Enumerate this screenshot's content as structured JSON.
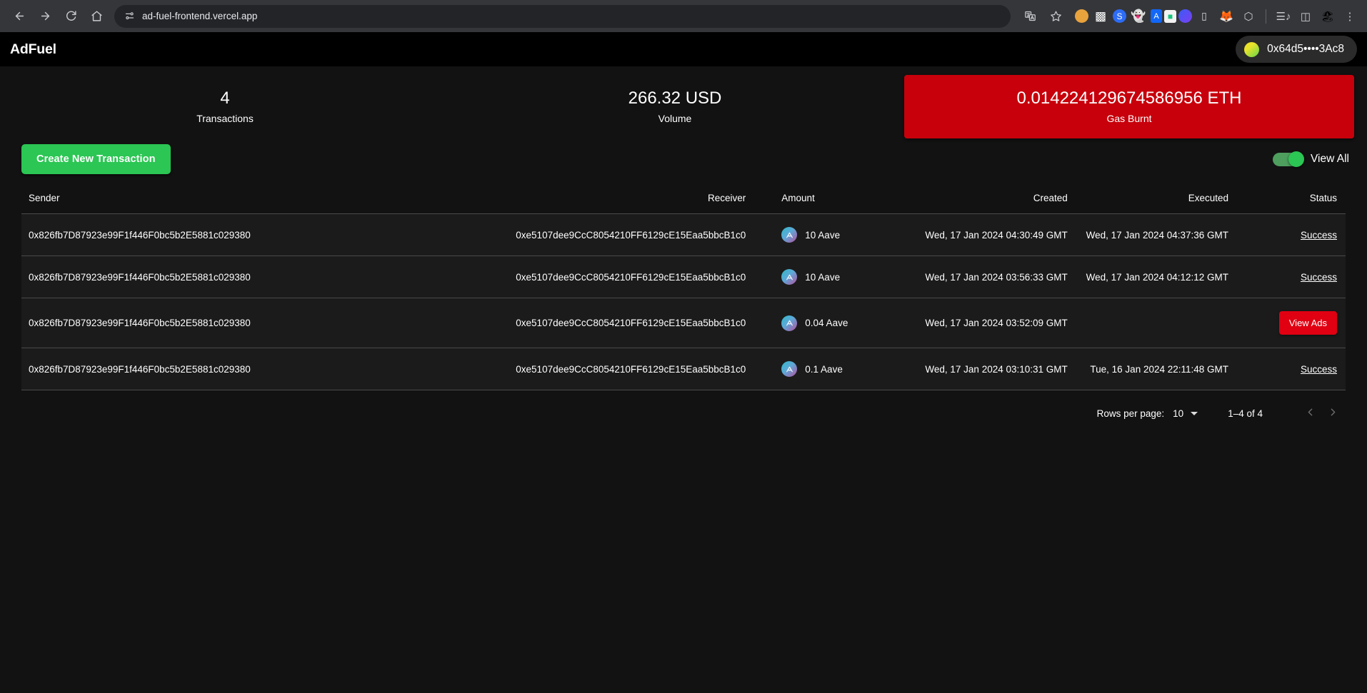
{
  "browser": {
    "back_icon": "back-arrow-icon",
    "forward_icon": "forward-arrow-icon",
    "reload_icon": "reload-icon",
    "home_icon": "home-icon",
    "site_info_icon": "site-settings-icon",
    "url": "ad-fuel-frontend.vercel.app",
    "translate_icon": "translate-icon",
    "bookmark_icon": "star-icon",
    "extensions": [
      {
        "name": "cookie-extension-icon",
        "glyph": "🍪",
        "color": "#e8a33d"
      },
      {
        "name": "qr-code-extension-icon",
        "glyph": "▒",
        "color": "#ffffff"
      },
      {
        "name": "blue-swirl-extension-icon",
        "glyph": "⌇",
        "color": "#2d6cf6"
      },
      {
        "name": "ghost-extension-icon",
        "glyph": "👻",
        "color": "#ab9ff2"
      },
      {
        "name": "argent-extension-icon",
        "glyph": "A",
        "color": "#1267f8"
      },
      {
        "name": "green-door-extension-icon",
        "glyph": "▫",
        "color": "#19c37d"
      },
      {
        "name": "rainbow-extension-icon",
        "glyph": "🌈",
        "color": "#6b5bf2"
      },
      {
        "name": "wallet-extension-icon",
        "glyph": "▭",
        "color": "#d8d8d8"
      },
      {
        "name": "fox-extension-icon",
        "glyph": "🦊",
        "color": "#e05fd8"
      },
      {
        "name": "keplr-extension-icon",
        "glyph": "⬡",
        "color": "#cfcfcf"
      }
    ],
    "extensions_puzzle_icon": "extensions-puzzle-icon",
    "playlist_icon": "playlist-icon",
    "side_panel_icon": "side-panel-icon",
    "profile_icon": "profile-avatar-icon",
    "menu_icon": "three-dot-menu-icon"
  },
  "app": {
    "brand": "AdFuel",
    "wallet_address": "0x64d5••••3Ac8",
    "accent_green": "#2bc653",
    "accent_red": "#c7000b"
  },
  "stats": [
    {
      "value": "4",
      "label": "Transactions",
      "highlight": false
    },
    {
      "value": "266.32 USD",
      "label": "Volume",
      "highlight": false
    },
    {
      "value": "0.014224129674586956 ETH",
      "label": "Gas Burnt",
      "highlight": true
    }
  ],
  "toolbar": {
    "create_label": "Create New Transaction",
    "toggle_label": "View All",
    "toggle_on": true
  },
  "table": {
    "headers": [
      "Sender",
      "Receiver",
      "Amount",
      "Created",
      "Executed",
      "Status"
    ],
    "rows": [
      {
        "sender": "0x826fb7D87923e99F1f446F0bc5b2E5881c029380",
        "receiver": "0xe5107dee9CcC8054210FF6129cE15Eaa5bbcB1c0",
        "amount": "10 Aave",
        "token_icon": "aave-token-icon",
        "created": "Wed, 17 Jan 2024 04:30:49 GMT",
        "executed": "Wed, 17 Jan 2024 04:37:36 GMT",
        "status": "Success",
        "status_type": "link"
      },
      {
        "sender": "0x826fb7D87923e99F1f446F0bc5b2E5881c029380",
        "receiver": "0xe5107dee9CcC8054210FF6129cE15Eaa5bbcB1c0",
        "amount": "10 Aave",
        "token_icon": "aave-token-icon",
        "created": "Wed, 17 Jan 2024 03:56:33 GMT",
        "executed": "Wed, 17 Jan 2024 04:12:12 GMT",
        "status": "Success",
        "status_type": "link"
      },
      {
        "sender": "0x826fb7D87923e99F1f446F0bc5b2E5881c029380",
        "receiver": "0xe5107dee9CcC8054210FF6129cE15Eaa5bbcB1c0",
        "amount": "0.04 Aave",
        "token_icon": "aave-token-icon",
        "created": "Wed, 17 Jan 2024 03:52:09 GMT",
        "executed": "",
        "status": "View Ads",
        "status_type": "button"
      },
      {
        "sender": "0x826fb7D87923e99F1f446F0bc5b2E5881c029380",
        "receiver": "0xe5107dee9CcC8054210FF6129cE15Eaa5bbcB1c0",
        "amount": "0.1 Aave",
        "token_icon": "aave-token-icon",
        "created": "Wed, 17 Jan 2024 03:10:31 GMT",
        "executed": "Tue, 16 Jan 2024 22:11:48 GMT",
        "status": "Success",
        "status_type": "link"
      }
    ]
  },
  "pagination": {
    "rows_label": "Rows per page:",
    "rows_value": "10",
    "range": "1–4 of 4",
    "prev_icon": "chevron-left-icon",
    "next_icon": "chevron-right-icon"
  }
}
